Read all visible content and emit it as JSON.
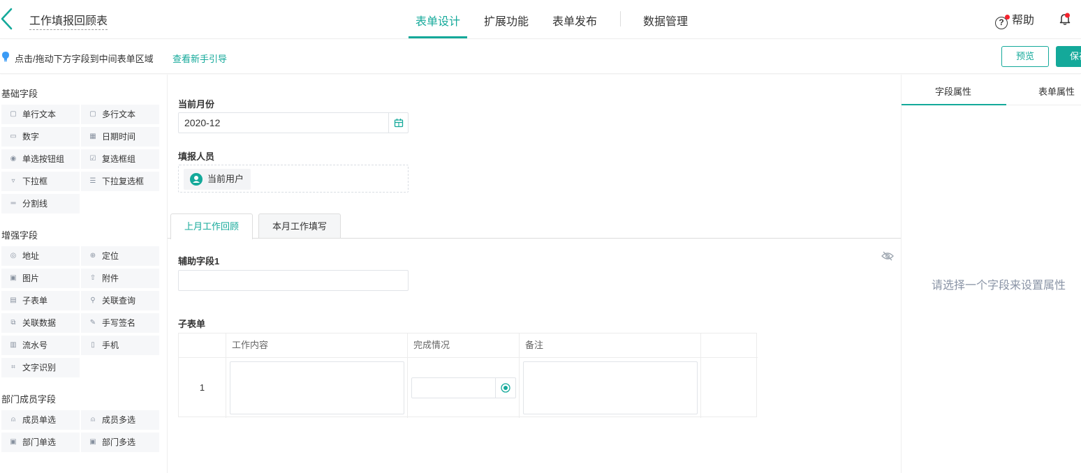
{
  "header": {
    "form_title": "工作填报回顾表",
    "tabs": [
      {
        "label": "表单设计",
        "active": true
      },
      {
        "label": "扩展功能",
        "active": false
      },
      {
        "label": "表单发布",
        "active": false
      },
      {
        "label": "数据管理",
        "active": false
      }
    ],
    "help_label": "帮助",
    "accent_color": "#14a99a"
  },
  "hint": {
    "text": "点击/拖动下方字段到中间表单区域",
    "link": "查看新手引导"
  },
  "actions": {
    "preview_label": "预览",
    "save_label": "保存"
  },
  "left_panel": {
    "groups": [
      {
        "title": "基础字段",
        "items": [
          {
            "label": "单行文本",
            "icon": "single-line-text-icon"
          },
          {
            "label": "多行文本",
            "icon": "multi-line-text-icon"
          },
          {
            "label": "数字",
            "icon": "number-icon"
          },
          {
            "label": "日期时间",
            "icon": "calendar-icon"
          },
          {
            "label": "单选按钮组",
            "icon": "radio-icon"
          },
          {
            "label": "复选框组",
            "icon": "checkbox-icon"
          },
          {
            "label": "下拉框",
            "icon": "dropdown-icon"
          },
          {
            "label": "下拉复选框",
            "icon": "dropdown-multi-icon"
          },
          {
            "label": "分割线",
            "icon": "divider-icon"
          }
        ]
      },
      {
        "title": "增强字段",
        "items": [
          {
            "label": "地址",
            "icon": "location-pin-icon"
          },
          {
            "label": "定位",
            "icon": "crosshair-icon"
          },
          {
            "label": "图片",
            "icon": "image-icon"
          },
          {
            "label": "附件",
            "icon": "upload-cloud-icon"
          },
          {
            "label": "子表单",
            "icon": "subform-icon"
          },
          {
            "label": "关联查询",
            "icon": "link-search-icon"
          },
          {
            "label": "关联数据",
            "icon": "link-data-icon"
          },
          {
            "label": "手写签名",
            "icon": "pen-icon"
          },
          {
            "label": "流水号",
            "icon": "serial-number-icon"
          },
          {
            "label": "手机",
            "icon": "phone-icon"
          },
          {
            "label": "文字识别",
            "icon": "ocr-icon"
          }
        ]
      },
      {
        "title": "部门成员字段",
        "items": [
          {
            "label": "成员单选",
            "icon": "user-icon"
          },
          {
            "label": "成员多选",
            "icon": "users-icon"
          },
          {
            "label": "部门单选",
            "icon": "department-icon"
          },
          {
            "label": "部门多选",
            "icon": "departments-icon"
          }
        ]
      }
    ]
  },
  "form": {
    "month_label": "当前月份",
    "month_value": "2020-12",
    "reporter_label": "填报人员",
    "reporter_value": "当前用户",
    "tabs": [
      {
        "label": "上月工作回顾",
        "active": true
      },
      {
        "label": "本月工作填写",
        "active": false
      }
    ],
    "aux_label": "辅助字段1",
    "subform_label": "子表单",
    "subform_columns": [
      "工作内容",
      "完成情况",
      "备注"
    ],
    "subform_row_number": "1"
  },
  "right_panel": {
    "tabs": [
      {
        "label": "字段属性",
        "active": true
      },
      {
        "label": "表单属性",
        "active": false
      }
    ],
    "empty_text": "请选择一个字段来设置属性"
  }
}
